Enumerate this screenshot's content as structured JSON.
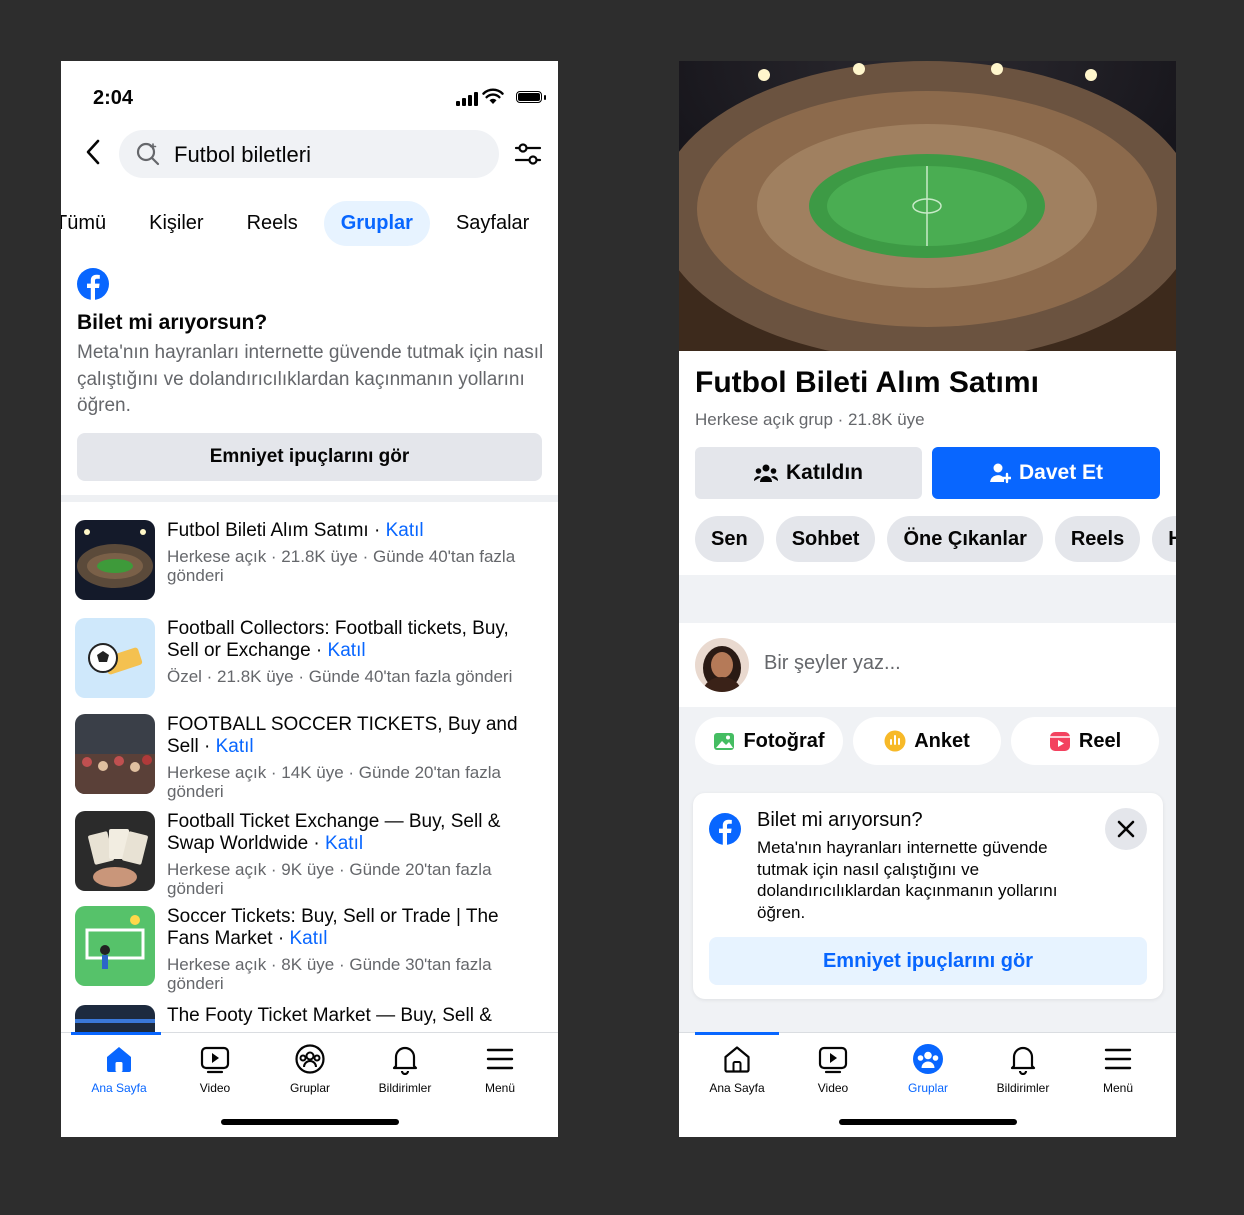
{
  "left": {
    "status": {
      "time": "2:04"
    },
    "search": {
      "query": "Futbol biletleri"
    },
    "tabs": [
      {
        "label": "Tümü",
        "active": false
      },
      {
        "label": "Kişiler",
        "active": false
      },
      {
        "label": "Reels",
        "active": false
      },
      {
        "label": "Gruplar",
        "active": true
      },
      {
        "label": "Sayfalar",
        "active": false
      }
    ],
    "notice": {
      "title": "Bilet mi arıyorsun?",
      "body": "Meta'nın hayranları internette güvende tutmak için nasıl çalıştığını ve dolandırıcılıklardan kaçınmanın yollarını öğren.",
      "button": "Emniyet ipuçlarını gör"
    },
    "groups": [
      {
        "title": "Futbol Bileti Alım Satımı",
        "join": "Katıl",
        "meta": "Herkese açık · 21.8K üye · Günde 40'tan fazla gönderi"
      },
      {
        "title": "Football Collectors: Football  tickets, Buy, Sell or Exchange",
        "join": "Katıl",
        "meta": "Özel · 21.8K üye · Günde 40'tan fazla gönderi"
      },
      {
        "title": "FOOTBALL SOCCER TICKETS, Buy and Sell",
        "join": "Katıl",
        "meta": "Herkese açık · 14K üye · Günde 20'tan fazla gönderi"
      },
      {
        "title": "Football Ticket Exchange — Buy, Sell & Swap Worldwide",
        "join": "Katıl",
        "meta": "Herkese açık · 9K üye · Günde 20'tan fazla gönderi"
      },
      {
        "title": "Soccer Tickets: Buy, Sell or Trade | The Fans Market",
        "join": "Katıl",
        "meta": "Herkese açık · 8K üye · Günde 30'tan fazla gönderi"
      },
      {
        "title": "The Footy Ticket Market — Buy, Sell &",
        "join": "",
        "meta": ""
      }
    ],
    "nav": [
      {
        "label": "Ana Sayfa",
        "icon": "home-icon",
        "active": true
      },
      {
        "label": "Video",
        "icon": "video-icon",
        "active": false
      },
      {
        "label": "Gruplar",
        "icon": "groups-icon",
        "active": false
      },
      {
        "label": "Bildirimler",
        "icon": "bell-icon",
        "active": false
      },
      {
        "label": "Menü",
        "icon": "menu-icon",
        "active": false
      }
    ]
  },
  "right": {
    "group": {
      "title": "Futbol Bileti Alım Satımı",
      "meta": "Herkese açık grup · 21.8K üye",
      "joined_label": "Katıldın",
      "invite_label": "Davet Et"
    },
    "chips": [
      "Sen",
      "Sohbet",
      "Öne Çıkanlar",
      "Reels",
      "H"
    ],
    "composer": {
      "placeholder": "Bir şeyler yaz..."
    },
    "actions": [
      {
        "label": "Fotoğraf",
        "icon": "photo-icon"
      },
      {
        "label": "Anket",
        "icon": "poll-icon"
      },
      {
        "label": "Reel",
        "icon": "reel-icon"
      }
    ],
    "card": {
      "title": "Bilet mi arıyorsun?",
      "body": "Meta'nın hayranları internette güvende tutmak için nasıl çalıştığını ve dolandırıcılıklardan kaçınmanın yollarını öğren.",
      "button": "Emniyet ipuçlarını gör"
    },
    "nav": [
      {
        "label": "Ana Sayfa",
        "icon": "home-icon",
        "active": false
      },
      {
        "label": "Video",
        "icon": "video-icon",
        "active": false
      },
      {
        "label": "Gruplar",
        "icon": "groups-icon",
        "active": true
      },
      {
        "label": "Bildirimler",
        "icon": "bell-icon",
        "active": false
      },
      {
        "label": "Menü",
        "icon": "menu-icon",
        "active": false
      }
    ]
  },
  "colors": {
    "brand_blue": "#0866FF",
    "surface_grey": "#E4E6EB",
    "text_secondary": "#65676B"
  }
}
